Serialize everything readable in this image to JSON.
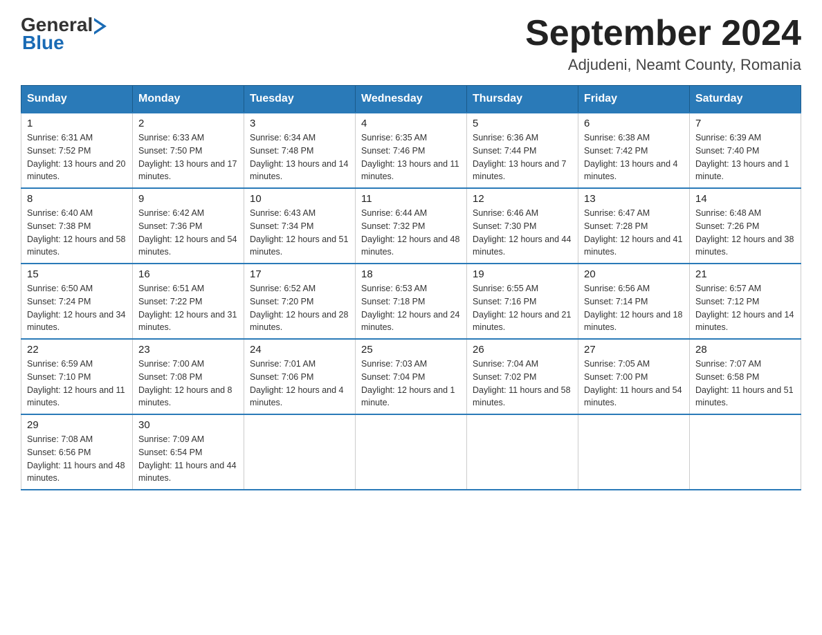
{
  "logo": {
    "general": "General",
    "blue": "Blue"
  },
  "title": "September 2024",
  "location": "Adjudeni, Neamt County, Romania",
  "days_header": [
    "Sunday",
    "Monday",
    "Tuesday",
    "Wednesday",
    "Thursday",
    "Friday",
    "Saturday"
  ],
  "weeks": [
    [
      {
        "day": "1",
        "sunrise": "6:31 AM",
        "sunset": "7:52 PM",
        "daylight": "13 hours and 20 minutes."
      },
      {
        "day": "2",
        "sunrise": "6:33 AM",
        "sunset": "7:50 PM",
        "daylight": "13 hours and 17 minutes."
      },
      {
        "day": "3",
        "sunrise": "6:34 AM",
        "sunset": "7:48 PM",
        "daylight": "13 hours and 14 minutes."
      },
      {
        "day": "4",
        "sunrise": "6:35 AM",
        "sunset": "7:46 PM",
        "daylight": "13 hours and 11 minutes."
      },
      {
        "day": "5",
        "sunrise": "6:36 AM",
        "sunset": "7:44 PM",
        "daylight": "13 hours and 7 minutes."
      },
      {
        "day": "6",
        "sunrise": "6:38 AM",
        "sunset": "7:42 PM",
        "daylight": "13 hours and 4 minutes."
      },
      {
        "day": "7",
        "sunrise": "6:39 AM",
        "sunset": "7:40 PM",
        "daylight": "13 hours and 1 minute."
      }
    ],
    [
      {
        "day": "8",
        "sunrise": "6:40 AM",
        "sunset": "7:38 PM",
        "daylight": "12 hours and 58 minutes."
      },
      {
        "day": "9",
        "sunrise": "6:42 AM",
        "sunset": "7:36 PM",
        "daylight": "12 hours and 54 minutes."
      },
      {
        "day": "10",
        "sunrise": "6:43 AM",
        "sunset": "7:34 PM",
        "daylight": "12 hours and 51 minutes."
      },
      {
        "day": "11",
        "sunrise": "6:44 AM",
        "sunset": "7:32 PM",
        "daylight": "12 hours and 48 minutes."
      },
      {
        "day": "12",
        "sunrise": "6:46 AM",
        "sunset": "7:30 PM",
        "daylight": "12 hours and 44 minutes."
      },
      {
        "day": "13",
        "sunrise": "6:47 AM",
        "sunset": "7:28 PM",
        "daylight": "12 hours and 41 minutes."
      },
      {
        "day": "14",
        "sunrise": "6:48 AM",
        "sunset": "7:26 PM",
        "daylight": "12 hours and 38 minutes."
      }
    ],
    [
      {
        "day": "15",
        "sunrise": "6:50 AM",
        "sunset": "7:24 PM",
        "daylight": "12 hours and 34 minutes."
      },
      {
        "day": "16",
        "sunrise": "6:51 AM",
        "sunset": "7:22 PM",
        "daylight": "12 hours and 31 minutes."
      },
      {
        "day": "17",
        "sunrise": "6:52 AM",
        "sunset": "7:20 PM",
        "daylight": "12 hours and 28 minutes."
      },
      {
        "day": "18",
        "sunrise": "6:53 AM",
        "sunset": "7:18 PM",
        "daylight": "12 hours and 24 minutes."
      },
      {
        "day": "19",
        "sunrise": "6:55 AM",
        "sunset": "7:16 PM",
        "daylight": "12 hours and 21 minutes."
      },
      {
        "day": "20",
        "sunrise": "6:56 AM",
        "sunset": "7:14 PM",
        "daylight": "12 hours and 18 minutes."
      },
      {
        "day": "21",
        "sunrise": "6:57 AM",
        "sunset": "7:12 PM",
        "daylight": "12 hours and 14 minutes."
      }
    ],
    [
      {
        "day": "22",
        "sunrise": "6:59 AM",
        "sunset": "7:10 PM",
        "daylight": "12 hours and 11 minutes."
      },
      {
        "day": "23",
        "sunrise": "7:00 AM",
        "sunset": "7:08 PM",
        "daylight": "12 hours and 8 minutes."
      },
      {
        "day": "24",
        "sunrise": "7:01 AM",
        "sunset": "7:06 PM",
        "daylight": "12 hours and 4 minutes."
      },
      {
        "day": "25",
        "sunrise": "7:03 AM",
        "sunset": "7:04 PM",
        "daylight": "12 hours and 1 minute."
      },
      {
        "day": "26",
        "sunrise": "7:04 AM",
        "sunset": "7:02 PM",
        "daylight": "11 hours and 58 minutes."
      },
      {
        "day": "27",
        "sunrise": "7:05 AM",
        "sunset": "7:00 PM",
        "daylight": "11 hours and 54 minutes."
      },
      {
        "day": "28",
        "sunrise": "7:07 AM",
        "sunset": "6:58 PM",
        "daylight": "11 hours and 51 minutes."
      }
    ],
    [
      {
        "day": "29",
        "sunrise": "7:08 AM",
        "sunset": "6:56 PM",
        "daylight": "11 hours and 48 minutes."
      },
      {
        "day": "30",
        "sunrise": "7:09 AM",
        "sunset": "6:54 PM",
        "daylight": "11 hours and 44 minutes."
      },
      null,
      null,
      null,
      null,
      null
    ]
  ],
  "labels": {
    "sunrise": "Sunrise:",
    "sunset": "Sunset:",
    "daylight": "Daylight:"
  }
}
